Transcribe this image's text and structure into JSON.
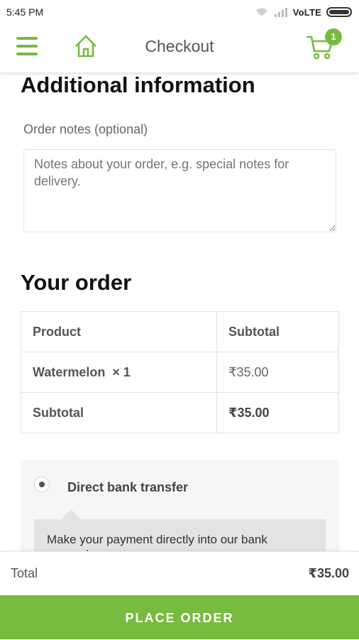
{
  "status_bar": {
    "time": "5:45 PM",
    "network": "VoLTE"
  },
  "app_bar": {
    "title": "Checkout",
    "cart_count": "1"
  },
  "additional_info": {
    "heading": "Additional information",
    "notes_label": "Order notes (optional)",
    "notes_placeholder": "Notes about your order, e.g. special notes for delivery.",
    "notes_value": ""
  },
  "order": {
    "heading": "Your order",
    "columns": [
      "Product",
      "Subtotal"
    ],
    "rows": [
      {
        "product": "Watermelon",
        "qty": "× 1",
        "price": "₹35.00"
      }
    ],
    "subtotal_label": "Subtotal",
    "subtotal_value": "₹35.00"
  },
  "payment": {
    "method_label": "Direct bank transfer",
    "selected": true,
    "description": "Make your payment directly into our bank account."
  },
  "footer": {
    "total_label": "Total",
    "total_value": "₹35.00",
    "place_order_label": "PLACE ORDER"
  },
  "colors": {
    "accent": "#77bb3f"
  },
  "icons": [
    "menu-icon",
    "home-icon",
    "cart-icon",
    "wifi-icon",
    "signal-icon",
    "battery-icon"
  ]
}
